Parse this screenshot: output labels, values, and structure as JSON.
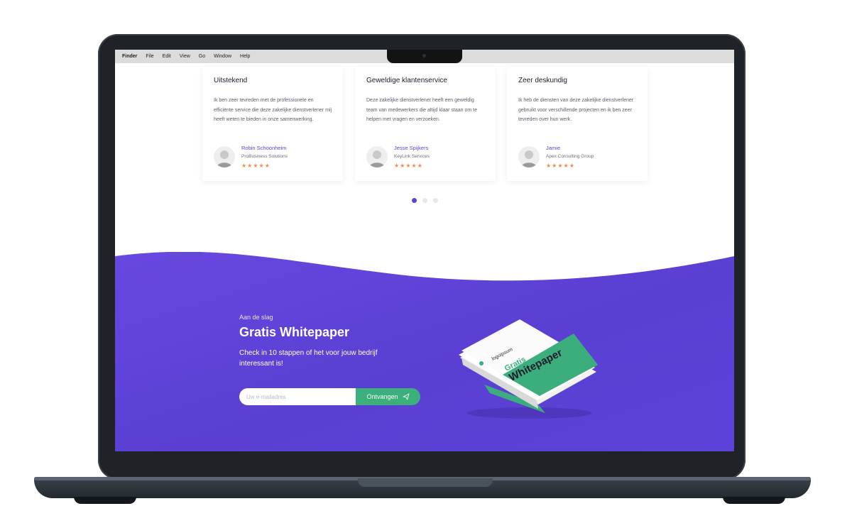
{
  "menubar": {
    "items": [
      "Finder",
      "File",
      "Edit",
      "View",
      "Go",
      "Window",
      "Help"
    ]
  },
  "testimonials": [
    {
      "title": "Uitstekend",
      "text": "Ik ben zeer tevreden met de professionele en efficiënte service die deze zakelijke dienstverlener mij heeft weten te bieden in onze samenwerking.",
      "name": "Robin Schoonheim",
      "company": "ProBusiness Solutions",
      "stars": "★★★★★"
    },
    {
      "title": "Geweldige klantenservice",
      "text": "Deze zakelijke dienstverlener heeft een geweldig team van medewerkers die altijd klaar staan om te helpen met vragen en verzoeken.",
      "name": "Jesse Spijkers",
      "company": "KeyLink Services",
      "stars": "★★★★★"
    },
    {
      "title": "Zeer deskundig",
      "text": "Ik heb de diensten van deze zakelijke dienstverlener gebruikt voor verschillende projecten en ik ben zeer tevreden over hun werk.",
      "name": "Jamie",
      "company": "Apex Consulting Group",
      "stars": "★★★★★"
    }
  ],
  "carousel": {
    "active_index": 0,
    "count": 3
  },
  "cta": {
    "eyebrow": "Aan de slag",
    "title": "Gratis Whitepaper",
    "description": "Check in 10 stappen of het voor jouw bedrijf interessant is!",
    "email_placeholder": "Uw e-mailadres",
    "button_label": "Ontvangen"
  },
  "whitepaper": {
    "logo_text": "logoipsum",
    "title_line1": "Gratis",
    "title_line2": "Whitepaper"
  },
  "colors": {
    "accent": "#5b45d6",
    "purple_bg": "#5f3fd8",
    "green": "#3bb07a",
    "stars": "#f08a4b"
  }
}
